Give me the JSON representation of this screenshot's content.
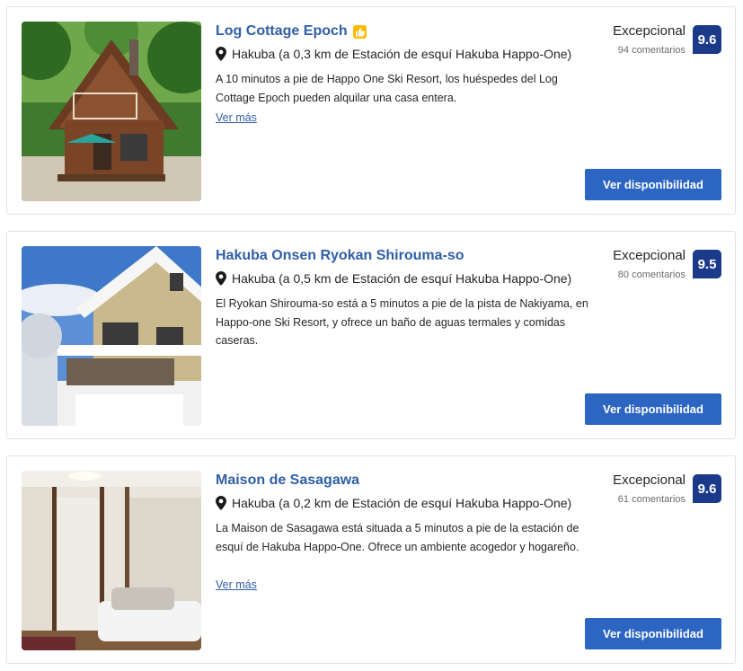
{
  "listings": [
    {
      "name": "Log Cottage Epoch",
      "has_badge": true,
      "badge_icon": "thumbs-up-icon",
      "location_icon": "map-pin-icon",
      "location": "Hakuba (a 0,3 km de Estación de esquí Hakuba Happo-One)",
      "description": "A 10 minutos a pie de Happo One Ski Resort, los huéspedes del Log Cottage Epoch pueden alquilar una casa entera.",
      "more_link": "Ver más",
      "rating_word": "Excepcional",
      "review_count": "94 comentarios",
      "score": "9.6",
      "cta": "Ver disponibilidad"
    },
    {
      "name": "Hakuba Onsen Ryokan Shirouma-so",
      "has_badge": false,
      "location_icon": "map-pin-icon",
      "location": "Hakuba (a 0,5 km de Estación de esquí Hakuba Happo-One)",
      "description": "El Ryokan Shirouma-so está a 5 minutos a pie de la pista de Nakiyama, en Happo-one Ski Resort, y ofrece un baño de aguas termales y comidas caseras.",
      "rating_word": "Excepcional",
      "review_count": "80 comentarios",
      "score": "9.5",
      "cta": "Ver disponibilidad"
    },
    {
      "name": "Maison de Sasagawa",
      "has_badge": false,
      "location_icon": "map-pin-icon",
      "location": "Hakuba (a 0,2 km de Estación de esquí Hakuba Happo-One)",
      "description": "La Maison de Sasagawa está situada a 5 minutos a pie de la estación de esquí de Hakuba Happo-One. Ofrece un ambiente acogedor y hogareño.",
      "more_link": "Ver más",
      "rating_word": "Excepcional",
      "review_count": "61 comentarios",
      "score": "9.6",
      "cta": "Ver disponibilidad"
    }
  ],
  "colors": {
    "title": "#2f5ea8",
    "score_bg": "#1b3a8a",
    "cta_bg": "#2c66c2",
    "badge": "#febb02"
  }
}
